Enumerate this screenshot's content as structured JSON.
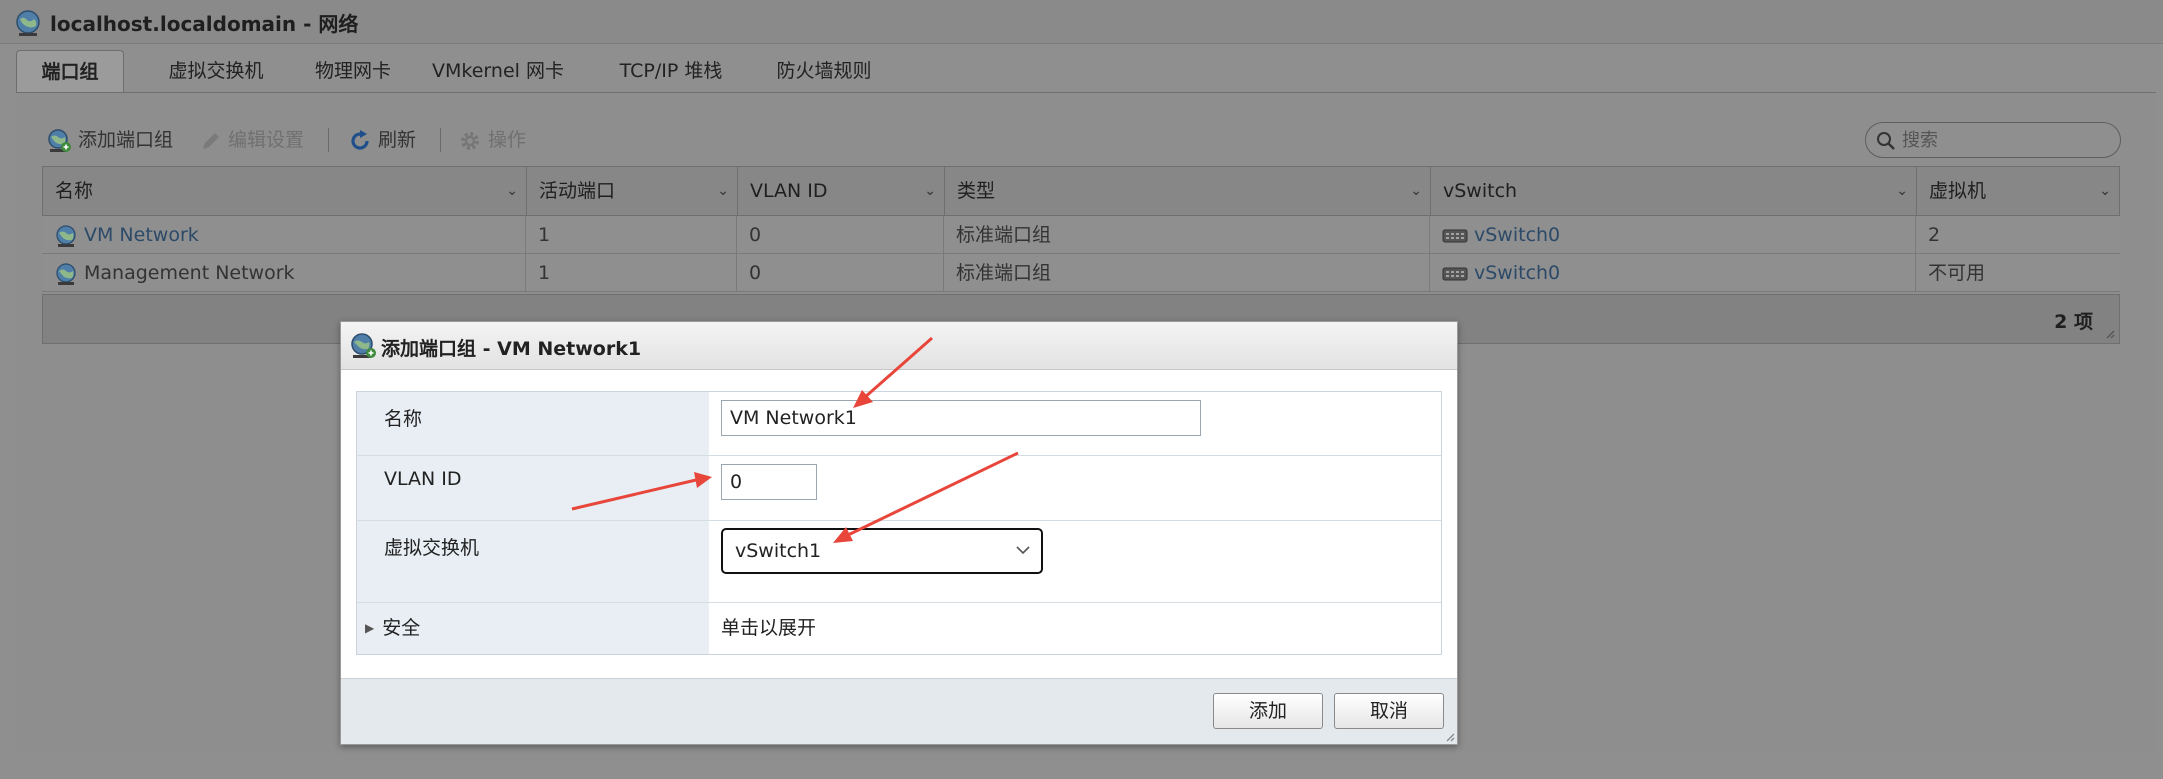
{
  "window": {
    "title": "localhost.localdomain - 网络"
  },
  "tabs": [
    {
      "label": "端口组",
      "active": true
    },
    {
      "label": "虚拟交换机",
      "active": false
    },
    {
      "label": "物理网卡",
      "active": false
    },
    {
      "label": "VMkernel 网卡",
      "active": false
    },
    {
      "label": "TCP/IP 堆栈",
      "active": false
    },
    {
      "label": "防火墙规则",
      "active": false
    }
  ],
  "toolbar": {
    "add_portgroup": "添加端口组",
    "edit_settings": "编辑设置",
    "refresh": "刷新",
    "actions": "操作",
    "search_placeholder": "搜索"
  },
  "grid": {
    "columns": [
      "名称",
      "活动端口",
      "VLAN ID",
      "类型",
      "vSwitch",
      "虚拟机"
    ],
    "rows": [
      {
        "name": "VM Network",
        "active_ports": "1",
        "vlan_id": "0",
        "type": "标准端口组",
        "vswitch": "vSwitch0",
        "vms": "2"
      },
      {
        "name": "Management Network",
        "active_ports": "1",
        "vlan_id": "0",
        "type": "标准端口组",
        "vswitch": "vSwitch0",
        "vms": "不可用"
      }
    ],
    "item_count": "2 项"
  },
  "dialog": {
    "title": "添加端口组 - VM Network1",
    "fields": {
      "name_label": "名称",
      "name_value": "VM Network1",
      "vlan_label": "VLAN ID",
      "vlan_value": "0",
      "vswitch_label": "虚拟交换机",
      "vswitch_value": "vSwitch1",
      "security_label": "安全",
      "security_value": "单击以展开"
    },
    "buttons": {
      "add": "添加",
      "cancel": "取消"
    }
  },
  "colors": {
    "annotation_arrow": "#e8463a",
    "link": "#2c4a68",
    "dialog_label_bg": "#e8eef4"
  }
}
